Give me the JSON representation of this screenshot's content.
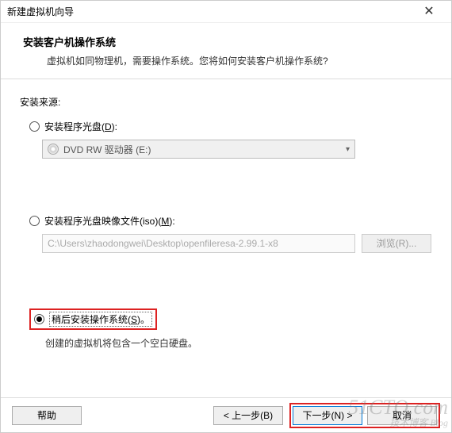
{
  "window": {
    "title": "新建虚拟机向导",
    "close_glyph": "✕"
  },
  "header": {
    "heading": "安装客户机操作系统",
    "subheading": "虚拟机如同物理机，需要操作系统。您将如何安装客户机操作系统?"
  },
  "source": {
    "label": "安装来源:",
    "opt_disc": {
      "label_pre": "安装程序光盘(",
      "key": "D",
      "label_post": "):"
    },
    "disc_combo": {
      "value": "DVD RW 驱动器 (E:)"
    },
    "opt_iso": {
      "label_pre": "安装程序光盘映像文件(iso)(",
      "key": "M",
      "label_post": "):"
    },
    "iso_path": "C:\\Users\\zhaodongwei\\Desktop\\openfileresa-2.99.1-x8",
    "browse": {
      "label_pre": "浏览(",
      "key": "R",
      "label_post": ")..."
    },
    "opt_later": {
      "label_pre": "稍后安装操作系统(",
      "key": "S",
      "label_post": ")。"
    },
    "later_hint": "创建的虚拟机将包含一个空白硬盘。"
  },
  "footer": {
    "help": "帮助",
    "back": {
      "pre": "< 上一步(",
      "key": "B",
      "post": ")"
    },
    "next": {
      "pre": "下一步(",
      "key": "N",
      "post": ") >"
    },
    "cancel": "取消"
  },
  "watermark": {
    "main": "51CTO.com",
    "sub": "技术博客 Blog"
  }
}
